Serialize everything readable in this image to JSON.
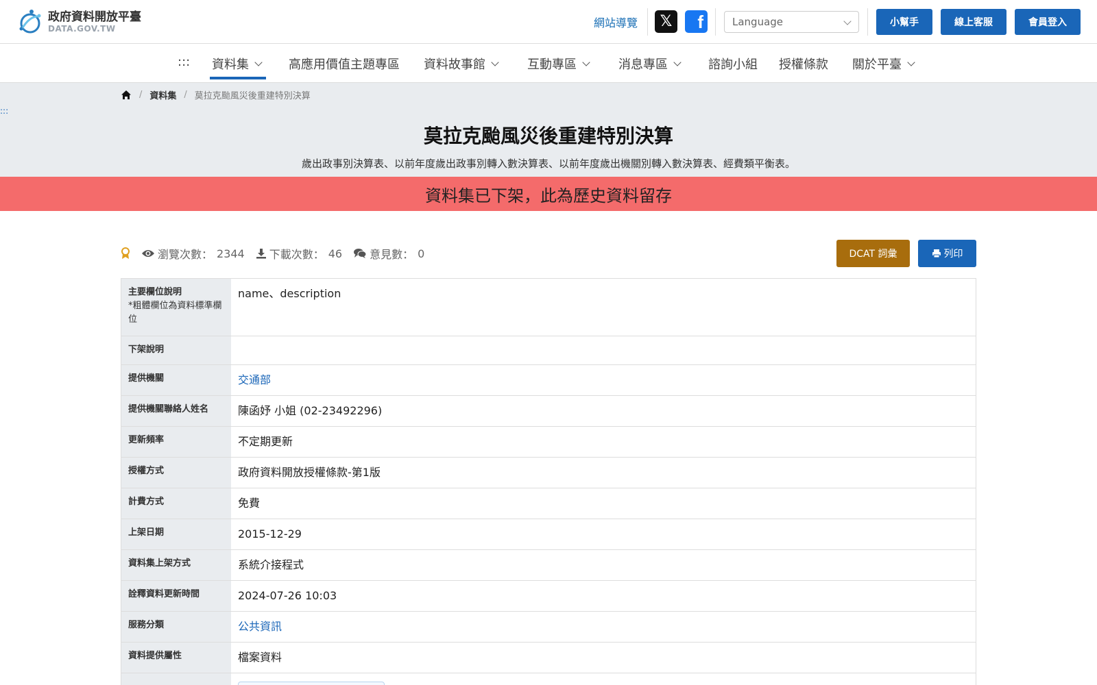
{
  "header": {
    "logo_title": "政府資料開放平臺",
    "logo_sub": "DATA.GOV.TW",
    "sitemap": "網站導覽",
    "language_placeholder": "Language",
    "helper_btn": "小幫手",
    "service_btn": "線上客服",
    "login_btn": "會員登入"
  },
  "nav": {
    "accesskey": ":::",
    "items": [
      "資料集",
      "高應用價值主題專區",
      "資料故事館",
      "互動專區",
      "消息專區",
      "諮詢小組",
      "授權條款",
      "關於平臺"
    ]
  },
  "breadcrumb": {
    "level1": "資料集",
    "current": "莫拉克颱風災後重建特別決算"
  },
  "hero": {
    "accesskey": ":::",
    "title": "莫拉克颱風災後重建特別決算",
    "description": "歲出政事別決算表、以前年度歲出政事別轉入數決算表、以前年度歲出機關別轉入數決算表、經費類平衡表。"
  },
  "alert": "資料集已下架，此為歷史資料留存",
  "stats": {
    "views_label": "瀏覽次數：",
    "views": "2344",
    "downloads_label": "下載次數：",
    "downloads": "46",
    "comments_label": "意見數：",
    "comments": "0"
  },
  "buttons": {
    "dcat": "DCAT 詞彙",
    "print": "列印"
  },
  "table": {
    "r0_k": "主要欄位說明",
    "r0_note": "*粗體欄位為資料標準欄位",
    "r0_v": "name、description",
    "r1_k": "下架說明",
    "r1_v": "",
    "r2_k": "提供機關",
    "r2_v": "交通部",
    "r3_k": "提供機關聯絡人姓名",
    "r3_v": "陳函妤 小姐 (02-23492296)",
    "r4_k": "更新頻率",
    "r4_v": "不定期更新",
    "r5_k": "授權方式",
    "r5_v": "政府資料開放授權條款-第1版",
    "r6_k": "計費方式",
    "r6_v": "免費",
    "r7_k": "上架日期",
    "r7_v": "2015-12-29",
    "r8_k": "資料集上架方式",
    "r8_v": "系統介接程式",
    "r9_k": "詮釋資料更新時間",
    "r9_v": "2024-07-26 10:03",
    "r10_k": "服務分類",
    "r10_v": "公共資訊",
    "r11_k": "資料提供屬性",
    "r11_v": "檔案資料"
  }
}
